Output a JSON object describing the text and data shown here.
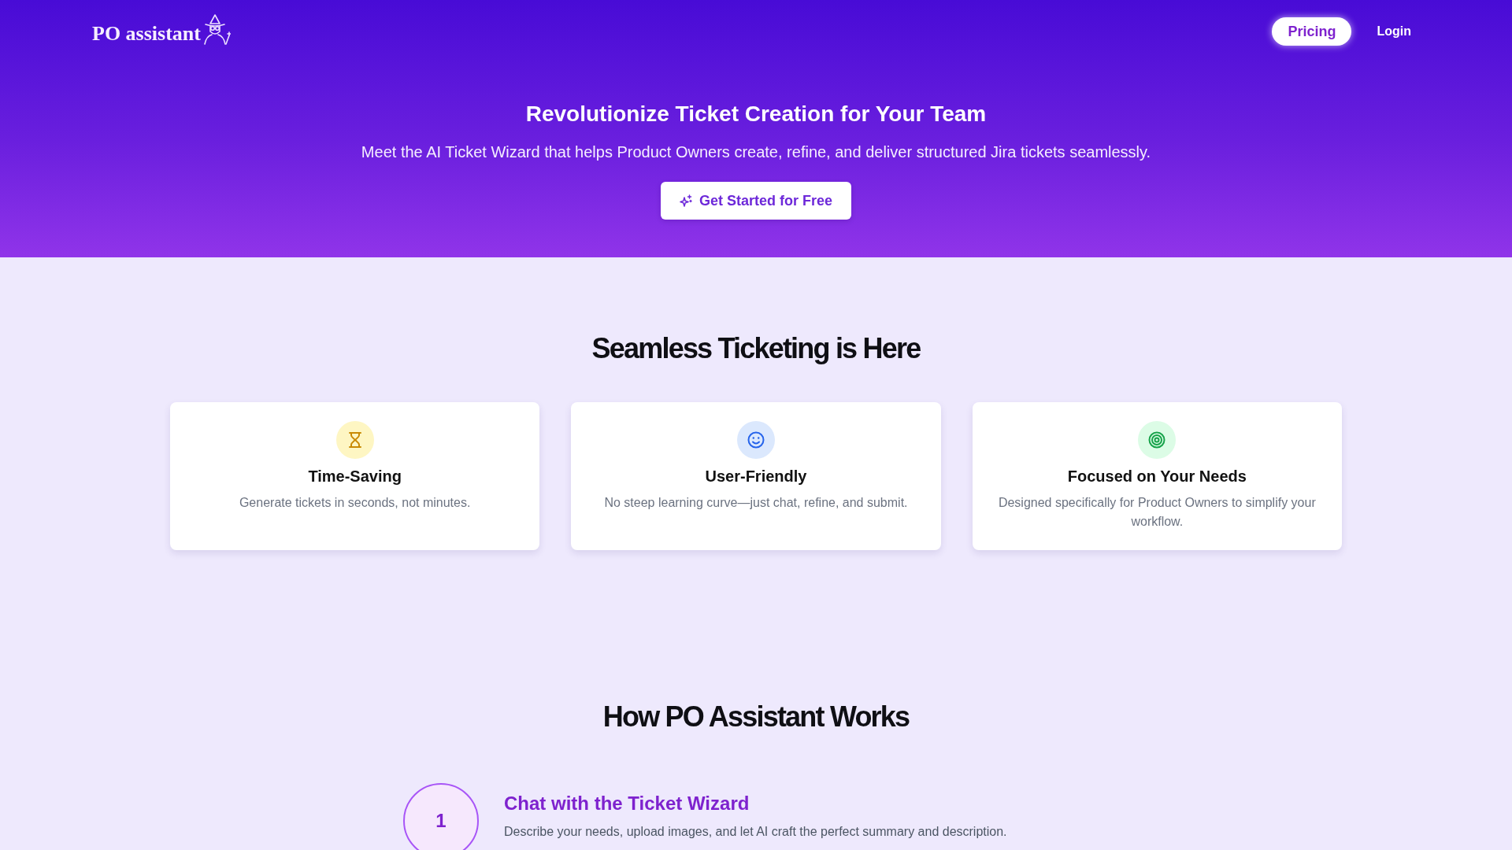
{
  "header": {
    "logo": "PO assistant",
    "nav": [
      {
        "kind": "pill",
        "label": "Pricing"
      },
      {
        "kind": "link",
        "label": "Login"
      }
    ]
  },
  "hero": {
    "title": "Revolutionize Ticket Creation for Your Team",
    "subtitle": "Meet the AI Ticket Wizard that helps Product Owners create, refine, and deliver structured Jira tickets seamlessly.",
    "cta": "Get Started for Free"
  },
  "features": {
    "heading": "Seamless Ticketing is Here",
    "cards": [
      {
        "kind": "hourglass",
        "title": "Time-Saving",
        "description": "Generate tickets in seconds, not minutes."
      },
      {
        "kind": "smiley",
        "title": "User-Friendly",
        "description": "No steep learning curve—just chat, refine, and submit."
      },
      {
        "kind": "target",
        "title": "Focused on Your Needs",
        "description": "Designed specifically for Product Owners to simplify your workflow."
      }
    ]
  },
  "how_it_works": {
    "heading": "How PO Assistant Works",
    "steps": [
      {
        "number": "1",
        "title": "Chat with the Ticket Wizard",
        "description": "Describe your needs, upload images, and let AI craft the perfect summary and description."
      }
    ]
  }
}
